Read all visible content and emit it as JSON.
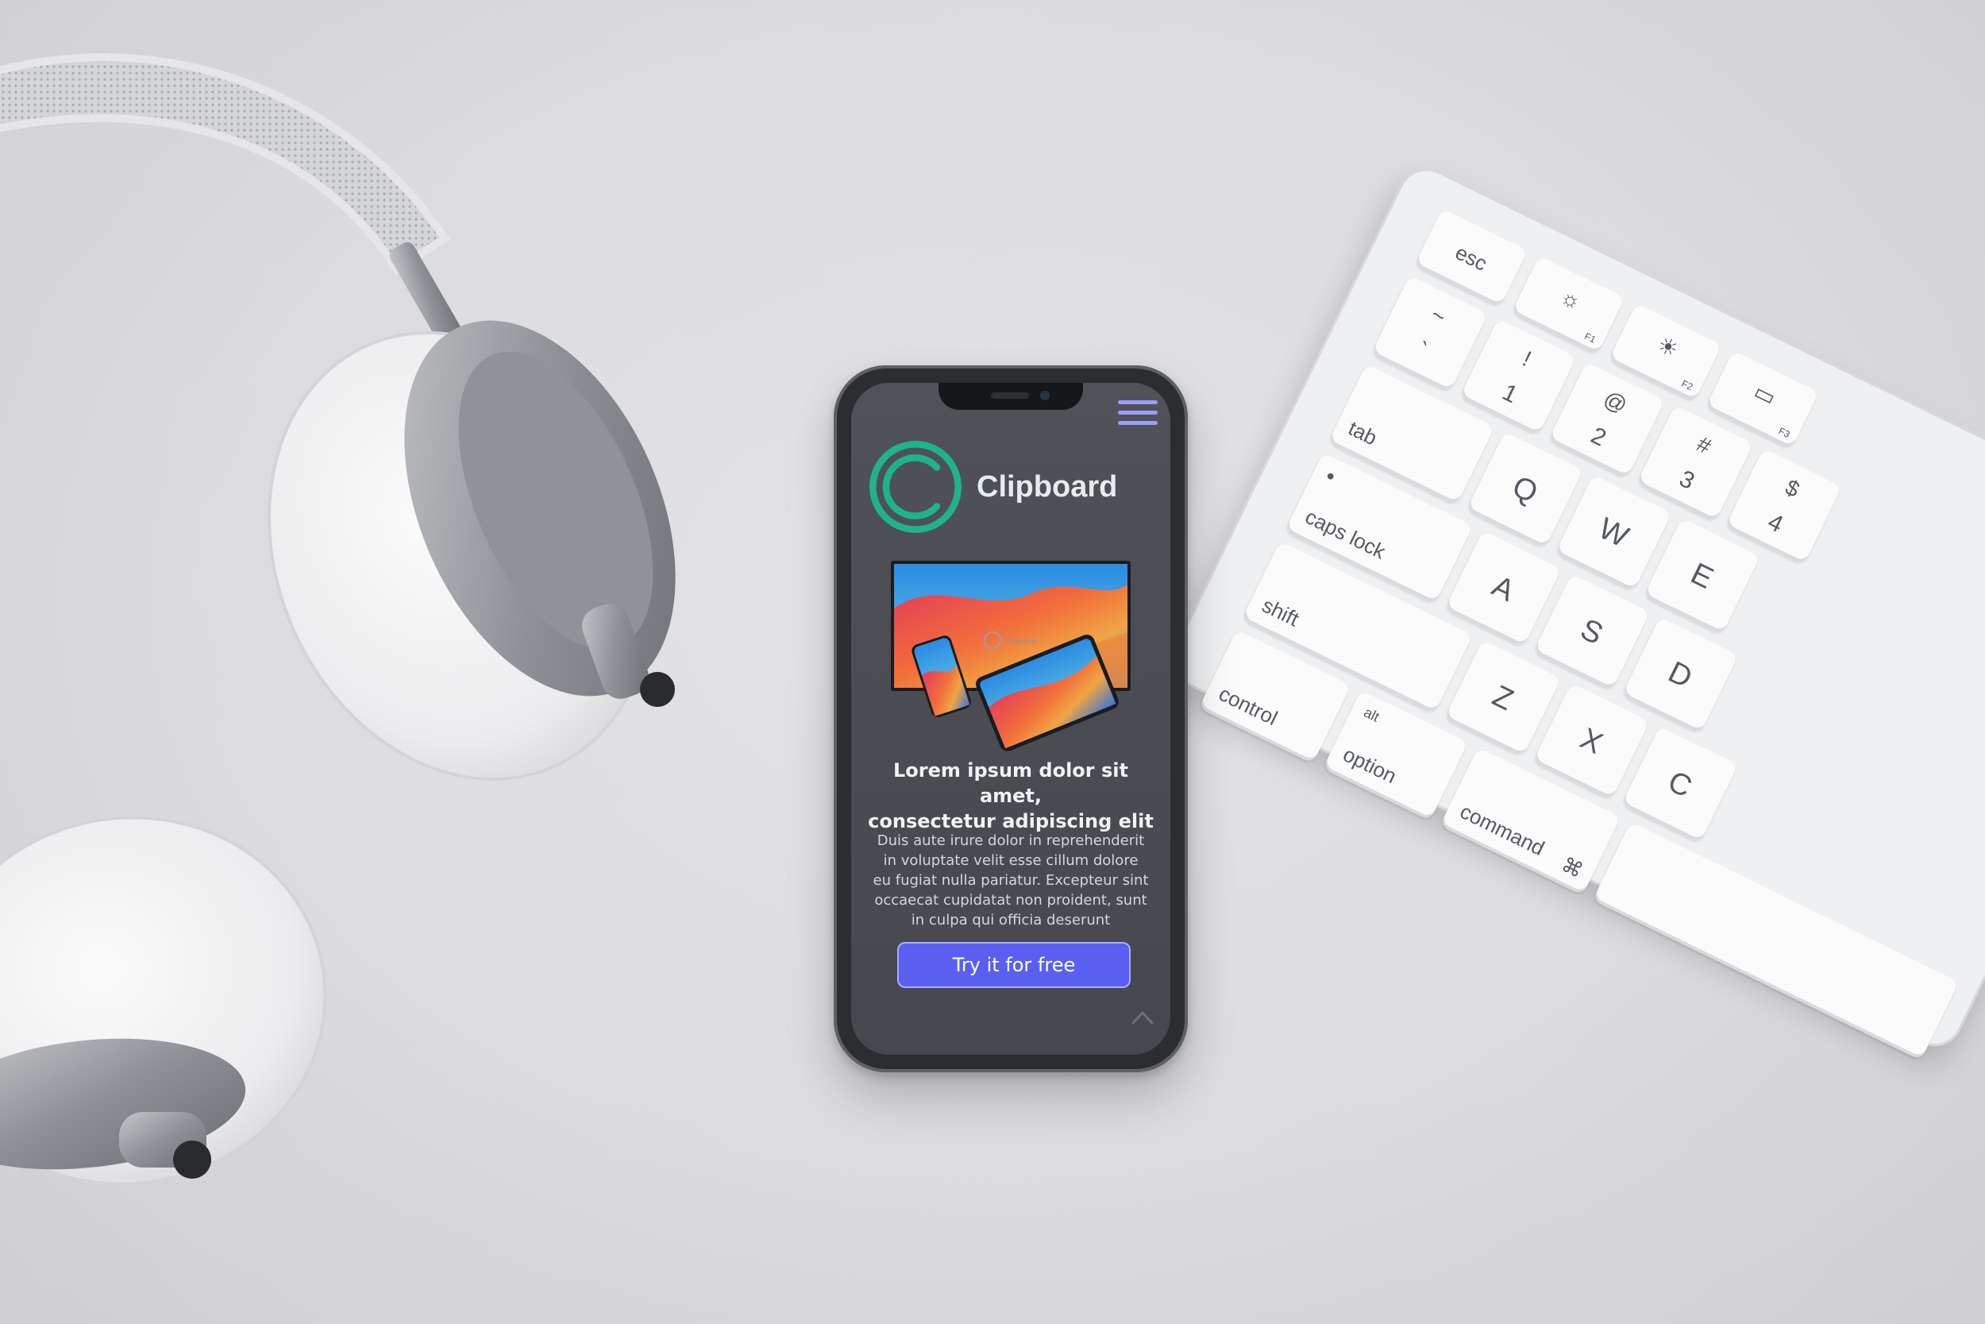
{
  "app": {
    "brand_name": "Clipboard",
    "colors": {
      "accent": "#5b5ff0",
      "logo_teal": "#1fb38a",
      "menu_icon": "#9b9ef5",
      "screen_bg": "#4b4d53"
    }
  },
  "hero": {
    "headline_line1": "Lorem ipsum dolor sit amet,",
    "headline_line2": "consectetur adipiscing elit",
    "body_lines": [
      "Duis aute irure dolor in reprehenderit",
      "in voluptate velit esse cillum dolore",
      "eu fugiat nulla pariatur. Excepteur sint",
      "occaecat cupidatat non proident, sunt",
      "in culpa qui officia deserunt"
    ],
    "cta_label": "Try it for free",
    "device_logo_text": "Clipboard"
  },
  "keyboard": {
    "esc": "esc",
    "f1": "F1",
    "f2": "F2",
    "f3": "F3",
    "tilde_top": "~",
    "tilde_bot": "`",
    "k1_top": "!",
    "k1_bot": "1",
    "k2_top": "@",
    "k2_bot": "2",
    "k3_top": "#",
    "k3_bot": "3",
    "k4_top": "$",
    "k4_bot": "4",
    "tab": "tab",
    "q": "Q",
    "w": "W",
    "e": "E",
    "caps": "caps lock",
    "a": "A",
    "s": "S",
    "d": "D",
    "shift": "shift",
    "z": "Z",
    "x": "X",
    "c": "C",
    "control": "control",
    "alt": "alt",
    "option": "option",
    "command": "command",
    "command_symbol": "⌘"
  }
}
